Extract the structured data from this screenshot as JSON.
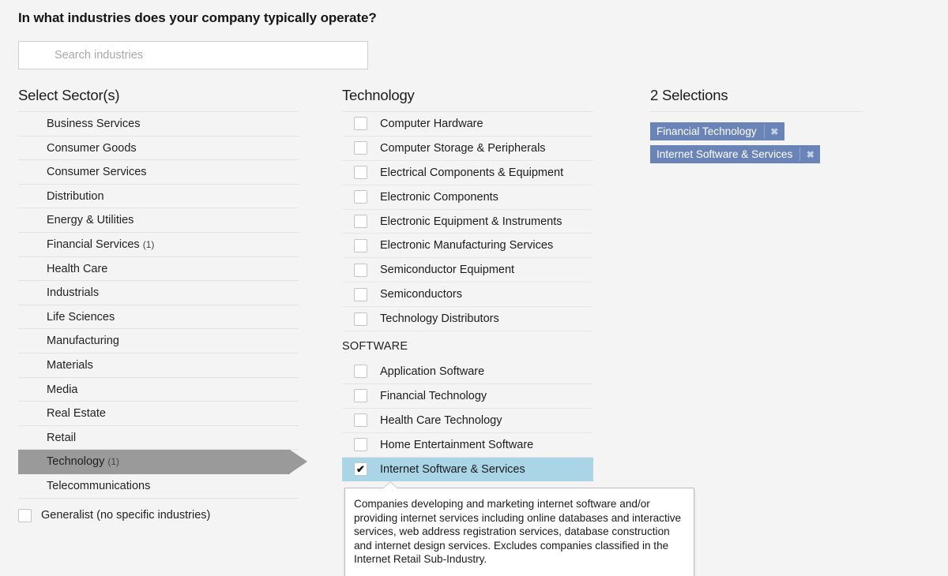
{
  "header": {
    "question": "In what industries does your company typically operate?"
  },
  "search": {
    "placeholder": "Search industries",
    "value": ""
  },
  "sectors_panel": {
    "title": "Select Sector(s)",
    "items": [
      {
        "label": "Business Services",
        "count": "",
        "selected": false
      },
      {
        "label": "Consumer Goods",
        "count": "",
        "selected": false
      },
      {
        "label": "Consumer Services",
        "count": "",
        "selected": false
      },
      {
        "label": "Distribution",
        "count": "",
        "selected": false
      },
      {
        "label": "Energy & Utilities",
        "count": "",
        "selected": false
      },
      {
        "label": "Financial Services",
        "count": "(1)",
        "selected": false
      },
      {
        "label": "Health Care",
        "count": "",
        "selected": false
      },
      {
        "label": "Industrials",
        "count": "",
        "selected": false
      },
      {
        "label": "Life Sciences",
        "count": "",
        "selected": false
      },
      {
        "label": "Manufacturing",
        "count": "",
        "selected": false
      },
      {
        "label": "Materials",
        "count": "",
        "selected": false
      },
      {
        "label": "Media",
        "count": "",
        "selected": false
      },
      {
        "label": "Real Estate",
        "count": "",
        "selected": false
      },
      {
        "label": "Retail",
        "count": "",
        "selected": false
      },
      {
        "label": "Technology",
        "count": "(1)",
        "selected": true
      },
      {
        "label": "Telecommunications",
        "count": "",
        "selected": false
      }
    ],
    "generalist": {
      "label": "Generalist (no specific industries)",
      "checked": false
    }
  },
  "industries_panel": {
    "title": "Technology",
    "items": [
      {
        "label": "Computer Hardware",
        "checked": false
      },
      {
        "label": "Computer Storage & Peripherals",
        "checked": false
      },
      {
        "label": "Electrical Components & Equipment",
        "checked": false
      },
      {
        "label": "Electronic Components",
        "checked": false
      },
      {
        "label": "Electronic Equipment & Instruments",
        "checked": false
      },
      {
        "label": "Electronic Manufacturing Services",
        "checked": false
      },
      {
        "label": "Semiconductor Equipment",
        "checked": false
      },
      {
        "label": "Semiconductors",
        "checked": false
      },
      {
        "label": "Technology Distributors",
        "checked": false
      }
    ],
    "group_label": "SOFTWARE",
    "group_items": [
      {
        "label": "Application Software",
        "checked": false
      },
      {
        "label": "Financial Technology",
        "checked": false
      },
      {
        "label": "Health Care Technology",
        "checked": false
      },
      {
        "label": "Home Entertainment Software",
        "checked": false
      },
      {
        "label": "Internet Software & Services",
        "checked": true
      }
    ],
    "tooltip": "Companies developing and marketing internet software and/or providing internet services including online databases and interactive services, web address registration services, database construction and internet design services. Excludes companies classified in the Internet Retail Sub-Industry."
  },
  "selections_panel": {
    "title": "2 Selections",
    "chips": [
      {
        "label": "Financial Technology",
        "remove": "✖"
      },
      {
        "label": "Internet Software & Services",
        "remove": "✖"
      }
    ]
  },
  "colors": {
    "page_background": "#f4f4f4",
    "selected_sector": "#9a9a9a",
    "checked_row": "#a9d5e7",
    "chip": "#6b84b8",
    "divider": "#e3e3e3"
  }
}
